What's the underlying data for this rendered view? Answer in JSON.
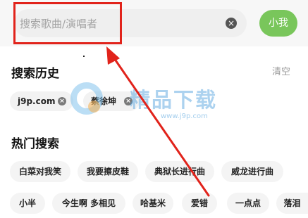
{
  "search": {
    "placeholder": "搜索歌曲/演唱者",
    "clear_icon": "×",
    "submit_label": "小我"
  },
  "history": {
    "title": "搜索历史",
    "clear_label": "清空",
    "items": [
      {
        "label": "j9p.com"
      },
      {
        "label": "蔡徐坤"
      }
    ],
    "delete_icon": "×"
  },
  "hot": {
    "title": "热门搜索",
    "items": [
      "白菜对我笑",
      "我要擦皮鞋",
      "典狱长进行曲",
      "威龙进行曲",
      "小半",
      "今生啊 多相见",
      "哈基米",
      "爱错",
      "一点点",
      "落泪"
    ]
  },
  "watermark": {
    "text": "精品下载",
    "url": "www.j9p.com"
  },
  "colors": {
    "accent_green": "#79c65b",
    "annotation_red": "#e1231b"
  }
}
